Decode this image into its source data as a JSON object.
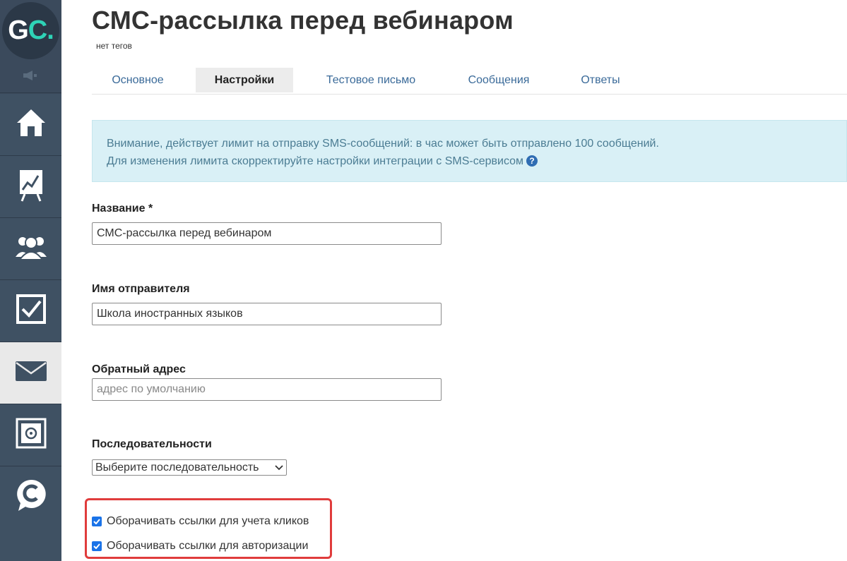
{
  "logo": {
    "letters": "G",
    "accent": "C",
    "dot": "."
  },
  "page": {
    "title": "СМС-рассылка перед вебинаром",
    "tags": "нет тегов"
  },
  "tabs": [
    {
      "label": "Основное"
    },
    {
      "label": "Настройки"
    },
    {
      "label": "Тестовое письмо"
    },
    {
      "label": "Сообщения"
    },
    {
      "label": "Ответы"
    }
  ],
  "alert": {
    "line1": "Внимание, действует лимит на отправку SMS-сообщений: в час может быть отправлено 100 сообщений.",
    "line2": "Для изменения лимита скорректируйте настройки интеграции с SMS-сервисом",
    "help": "?"
  },
  "form": {
    "name": {
      "label": "Название *",
      "value": "СМС-рассылка перед вебинаром"
    },
    "sender": {
      "label": "Имя отправителя",
      "value": "Школа иностранных языков"
    },
    "reply": {
      "label": "Обратный адрес",
      "placeholder": "адрес по умолчанию"
    },
    "sequence": {
      "label": "Последовательности",
      "selected": "Выберите последовательность"
    },
    "wrap_clicks": {
      "label": "Оборачивать ссылки для учета кликов",
      "checked": true
    },
    "wrap_auth": {
      "label": "Оборачивать ссылки для авторизации",
      "checked": true
    }
  },
  "sidebar": {
    "items": [
      {
        "icon": "home-icon"
      },
      {
        "icon": "chart-board-icon"
      },
      {
        "icon": "users-icon"
      },
      {
        "icon": "checkbox-icon"
      },
      {
        "icon": "envelope-icon",
        "active": true
      },
      {
        "icon": "safe-icon"
      },
      {
        "icon": "chat-c-icon"
      }
    ]
  },
  "colors": {
    "sidebar_bg": "#3f5163",
    "accent": "#2ed3b7",
    "highlight": "#e03c3c",
    "link": "#3a6a99"
  }
}
